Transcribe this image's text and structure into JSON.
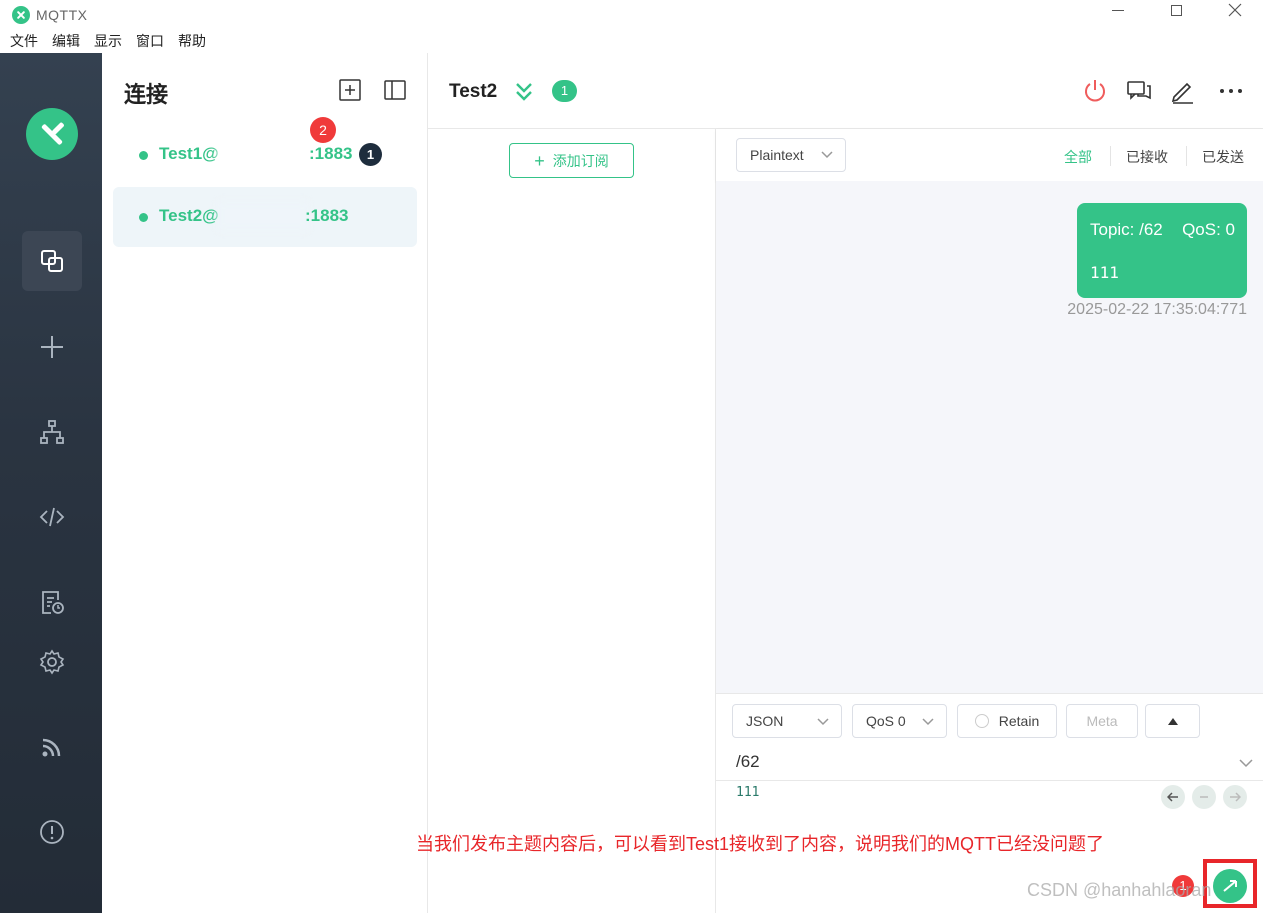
{
  "window": {
    "title": "MQTTX",
    "menu": [
      "文件",
      "编辑",
      "显示",
      "窗口",
      "帮助"
    ]
  },
  "nav": {
    "items": [
      {
        "icon": "connections-icon",
        "active": true
      },
      {
        "icon": "plus-icon",
        "active": false
      },
      {
        "icon": "topology-icon",
        "active": false
      },
      {
        "icon": "script-icon",
        "active": false
      },
      {
        "icon": "log-icon",
        "active": false
      },
      {
        "icon": "settings-icon",
        "active": false
      },
      {
        "icon": "feed-icon",
        "active": false
      },
      {
        "icon": "about-icon",
        "active": false
      }
    ]
  },
  "connections": {
    "heading": "连接",
    "items": [
      {
        "name_prefix": "Test1@",
        "port": ":1883",
        "status": "connected",
        "unread": "1",
        "annotation_badge": "2"
      },
      {
        "name_prefix": "Test2@",
        "port": ":1883",
        "status": "connected",
        "selected": true
      }
    ]
  },
  "header": {
    "connection_name": "Test2",
    "subscription_count": "1"
  },
  "subscriptions": {
    "add_label": "添加订阅"
  },
  "messages": {
    "payload_format": "Plaintext",
    "filters": [
      "全部",
      "已接收",
      "已发送"
    ],
    "active_filter": "全部",
    "items": [
      {
        "topic_label": "Topic: /62",
        "qos_label": "QoS: 0",
        "payload": "111",
        "time": "2025-02-22 17:35:04:771",
        "direction": "sent"
      }
    ]
  },
  "composer": {
    "format": "JSON",
    "qos": "QoS 0",
    "retain_label": "Retain",
    "meta_label": "Meta",
    "topic": "/62",
    "payload": "111"
  },
  "annotation": {
    "text": "当我们发布主题内容后，可以看到Test1接收到了内容，说明我们的MQTT已经没问题了",
    "badge": "1",
    "watermark": "CSDN @hanhahlaoran"
  },
  "colors": {
    "accent": "#34c388",
    "nav_bg": "#2a3441",
    "annotation_red": "#e8262a"
  }
}
